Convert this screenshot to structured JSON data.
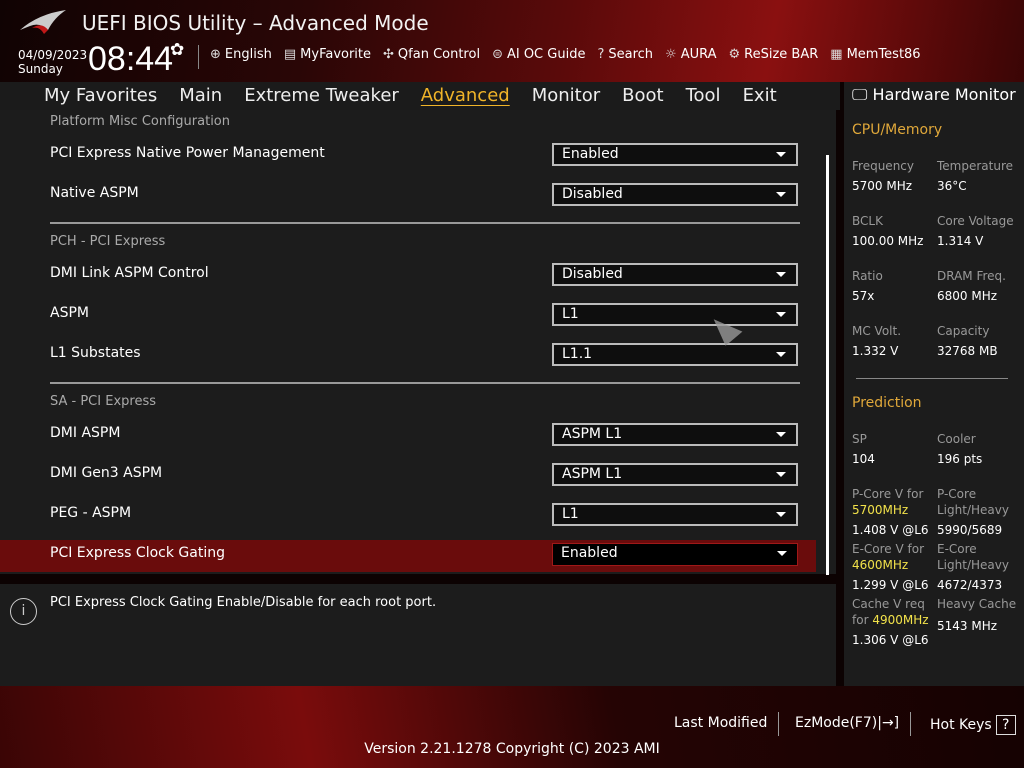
{
  "header": {
    "title": "UEFI BIOS Utility – Advanced Mode",
    "date": "04/09/2023",
    "day": "Sunday",
    "time": "08:44",
    "tools": [
      {
        "icon": "globe-icon",
        "g": "⊕",
        "label": "English"
      },
      {
        "icon": "favorite-icon",
        "g": "▤",
        "label": "MyFavorite"
      },
      {
        "icon": "fan-icon",
        "g": "✣",
        "label": "Qfan Control"
      },
      {
        "icon": "ai-oc-icon",
        "g": "⊜",
        "label": "AI OC Guide"
      },
      {
        "icon": "search-icon",
        "g": "?",
        "label": "Search"
      },
      {
        "icon": "aura-icon",
        "g": "☼",
        "label": "AURA"
      },
      {
        "icon": "resize-bar-icon",
        "g": "⚙",
        "label": "ReSize BAR"
      },
      {
        "icon": "memtest-icon",
        "g": "▦",
        "label": "MemTest86"
      }
    ]
  },
  "menu": [
    "My Favorites",
    "Main",
    "Extreme Tweaker",
    "Advanced",
    "Monitor",
    "Boot",
    "Tool",
    "Exit"
  ],
  "active_menu": 3,
  "settings": [
    {
      "type": "section",
      "label": "Platform Misc Configuration"
    },
    {
      "type": "item",
      "label": "PCI Express Native Power Management",
      "value": "Enabled"
    },
    {
      "type": "item",
      "label": "Native ASPM",
      "value": "Disabled"
    },
    {
      "type": "divider"
    },
    {
      "type": "section",
      "label": "PCH - PCI Express"
    },
    {
      "type": "item",
      "label": "DMI Link ASPM Control",
      "value": "Disabled"
    },
    {
      "type": "item",
      "label": "ASPM",
      "value": "L1"
    },
    {
      "type": "item",
      "label": "L1 Substates",
      "value": "L1.1"
    },
    {
      "type": "divider"
    },
    {
      "type": "section",
      "label": "SA - PCI Express"
    },
    {
      "type": "item",
      "label": "DMI ASPM",
      "value": "ASPM L1"
    },
    {
      "type": "item",
      "label": "DMI Gen3 ASPM",
      "value": "ASPM L1"
    },
    {
      "type": "item",
      "label": "PEG - ASPM",
      "value": "L1"
    },
    {
      "type": "item",
      "label": "PCI Express Clock Gating",
      "value": "Enabled",
      "selected": true
    }
  ],
  "help": "PCI Express Clock Gating Enable/Disable for each root port.",
  "hw": {
    "title": "Hardware Monitor",
    "cpu_title": "CPU/Memory",
    "cpu": [
      [
        "Frequency",
        "5700 MHz"
      ],
      [
        "Temperature",
        "36°C"
      ],
      [
        "BCLK",
        "100.00 MHz"
      ],
      [
        "Core Voltage",
        "1.314 V"
      ],
      [
        "Ratio",
        "57x"
      ],
      [
        "DRAM Freq.",
        "6800 MHz"
      ],
      [
        "MC Volt.",
        "1.332 V"
      ],
      [
        "Capacity",
        "32768 MB"
      ]
    ],
    "pred_title": "Prediction",
    "sp_k": "SP",
    "sp_v": "104",
    "cooler_k": "Cooler",
    "cooler_v": "196 pts",
    "pcore_k": "P-Core V for",
    "pcore_f": "5700MHz",
    "pcore_v": "1.408 V @L6",
    "pcl_k1": "P-Core",
    "pcl_k2": "Light/Heavy",
    "pcl_v": "5990/5689",
    "ecore_k": "E-Core V for",
    "ecore_f": "4600MHz",
    "ecore_v": "1.299 V @L6",
    "ecl_k1": "E-Core",
    "ecl_k2": "Light/Heavy",
    "ecl_v": "4672/4373",
    "cache_k1": "Cache V req",
    "cache_k2": "for",
    "cache_f": "4900MHz",
    "cache_v": "1.306 V @L6",
    "hc_k": "Heavy Cache",
    "hc_v": "5143 MHz"
  },
  "footer": {
    "last_modified": "Last Modified",
    "ezmode": "EzMode(F7)|",
    "hotkeys": "Hot Keys",
    "hotkeys_icon": "?",
    "version": "Version 2.21.1278 Copyright (C) 2023 AMI"
  },
  "colors": {
    "accent": "#f0b429",
    "selected_row": "#6a0c0c",
    "highlight": "#f2e24a"
  }
}
